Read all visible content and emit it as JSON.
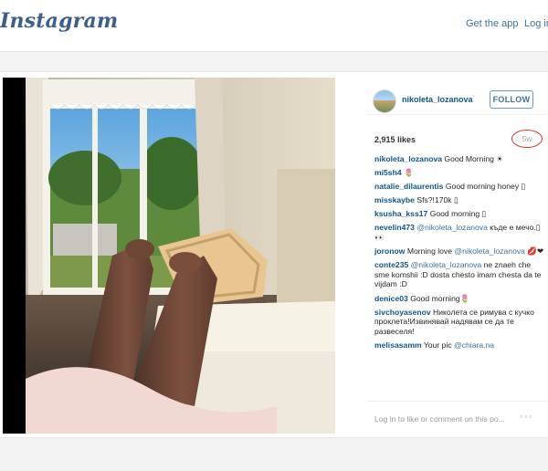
{
  "topbar": {
    "logo_text": "Instagram",
    "get_app_label": "Get the app",
    "login_label": "Log in"
  },
  "post": {
    "username": "nikoleta_lozanova",
    "follow_label": "FOLLOW",
    "likes": "2,915 likes",
    "timestamp": "5w",
    "comments": [
      {
        "user": "nikoleta_lozanova",
        "text": "Good Morning ☀"
      },
      {
        "user": "mi5sh4",
        "text": "🌷"
      },
      {
        "user": "natalie_dilaurentis",
        "text": "Good morning honey ▯"
      },
      {
        "user": "misskaybe",
        "text": "Sfs?!170k ▯"
      },
      {
        "user": "ksusha_kss17",
        "text": "Good morning ▯"
      },
      {
        "user": "nevelin473",
        "mention": "@nikoleta_lozanova",
        "text": "къде е мечо.▯👀"
      },
      {
        "user": "joronow",
        "text": "Morning love",
        "mention": "@nikoleta_lozanova",
        "text2": "💋❤"
      },
      {
        "user": "conte235",
        "mention": "@nikoleta_lozanova",
        "text": "ne znaeh che sme komshii :D dosta chesto imam chesta da te vijdam :D"
      },
      {
        "user": "denice03",
        "text": "Good morning🌷"
      },
      {
        "user": "sivchoyasenov",
        "text": "Николета се римува с кучко проклета!Извинявай надявам се да те развеселя!"
      },
      {
        "user": "melisasamm",
        "text": "Your pic",
        "mention": "@chiara.na"
      }
    ],
    "footer_cta": "Log in to like or comment on this po...",
    "more_icon": "◦◦◦"
  }
}
